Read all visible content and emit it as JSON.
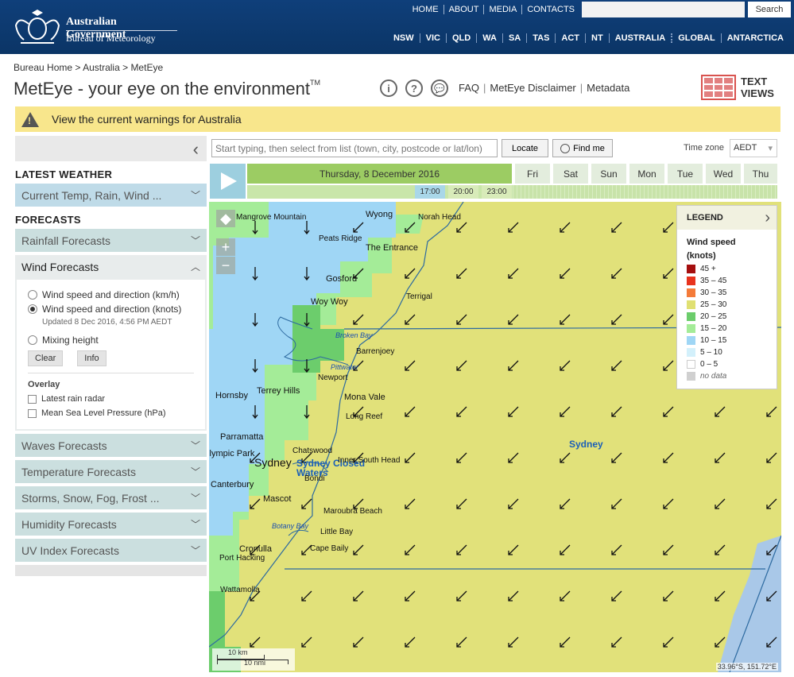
{
  "header": {
    "gov_name": "Australian Government",
    "bureau_name": "Bureau of Meteorology",
    "top_links": [
      "HOME",
      "ABOUT",
      "MEDIA",
      "CONTACTS"
    ],
    "search_button": "Search",
    "state_links": [
      "NSW",
      "VIC",
      "QLD",
      "WA",
      "SA",
      "TAS",
      "ACT",
      "NT",
      "AUSTRALIA",
      "GLOBAL",
      "ANTARCTICA"
    ]
  },
  "breadcrumb": {
    "home": "Bureau Home",
    "sep1": " > ",
    "australia": "Australia",
    "sep2": " > ",
    "current": "MetEye"
  },
  "title": {
    "main": "MetEye",
    "dash": " - ",
    "sub": "your eye on the environment",
    "tm": "TM"
  },
  "help_icons": {
    "info": "i",
    "help": "?",
    "feedback": "💬"
  },
  "title_links": {
    "faq": "FAQ",
    "disclaimer": "MetEye Disclaimer",
    "metadata": "Metadata"
  },
  "text_views": {
    "line1": "TEXT",
    "line2": "VIEWS"
  },
  "warning": {
    "text": "View the current warnings for Australia"
  },
  "sidebar": {
    "latest_heading": "LATEST WEATHER",
    "latest_item": "Current Temp, Rain, Wind ...",
    "forecasts_heading": "FORECASTS",
    "rainfall": "Rainfall Forecasts",
    "wind": "Wind Forecasts",
    "wind_options": {
      "kmh": "Wind speed and direction (km/h)",
      "knots": "Wind speed and direction (knots)",
      "updated": "Updated 8 Dec 2016, 4:56 PM AEDT",
      "mixing": "Mixing height"
    },
    "clear_button": "Clear",
    "info_button": "Info",
    "overlay_heading": "Overlay",
    "overlay_radar": "Latest rain radar",
    "overlay_pressure": "Mean Sea Level Pressure (hPa)",
    "waves": "Waves Forecasts",
    "temperature": "Temperature Forecasts",
    "storms": "Storms, Snow, Fog, Frost ...",
    "humidity": "Humidity Forecasts",
    "uv": "UV Index Forecasts"
  },
  "toolbar": {
    "location_placeholder": "Start typing, then select from list (town, city, postcode or lat/lon)",
    "locate_button": "Locate",
    "findme_button": "Find me",
    "timezone_label": "Time zone",
    "timezone_value": "AEDT"
  },
  "timeline": {
    "selected_day": "Thursday, 8 December 2016",
    "days": [
      "Fri",
      "Sat",
      "Sun",
      "Mon",
      "Tue",
      "Wed",
      "Thu"
    ],
    "hours": [
      "17:00",
      "20:00",
      "23:00"
    ],
    "active_hour": "17:00"
  },
  "map": {
    "places": [
      "Mangrove Mountain",
      "Wyong",
      "Norah Head",
      "Peats Ridge",
      "The Entrance",
      "Gosford",
      "Terrigal",
      "Woy Woy",
      "Broken Bay",
      "Barrenjoey",
      "Pittwater",
      "Newport",
      "Hornsby",
      "Terrey Hills",
      "Mona Vale",
      "Long Reef",
      "Parramatta",
      "Chatswood",
      "Sydney Closed Waters",
      "Olympic Park",
      "Sydney",
      "Inner South Head",
      "Bondi",
      "Canterbury",
      "Mascot",
      "Maroubra Beach",
      "Botany Bay",
      "Little Bay",
      "Cronulla",
      "Cape Baily",
      "Port Hacking",
      "Wattamolla"
    ],
    "region_label": "Sydney",
    "scale_km": "10 km",
    "scale_nmi": "10 nmi",
    "coords": "33.96°S, 151.72°E",
    "zoom_in": "+",
    "zoom_out": "−"
  },
  "legend": {
    "header": "LEGEND",
    "title_line1": "Wind speed",
    "title_line2": "(knots)",
    "items": [
      {
        "label": "45 +",
        "color": "#a50f0f"
      },
      {
        "label": "35 – 45",
        "color": "#e8331d"
      },
      {
        "label": "30 – 35",
        "color": "#f47b3a"
      },
      {
        "label": "25 – 30",
        "color": "#e0e072"
      },
      {
        "label": "20 – 25",
        "color": "#6ccd6c"
      },
      {
        "label": "15 – 20",
        "color": "#a4ec98"
      },
      {
        "label": "10 – 15",
        "color": "#9fd6f5"
      },
      {
        "label": "5 – 10",
        "color": "#d3f0fb"
      },
      {
        "label": "0 – 5",
        "color": "#ffffff"
      },
      {
        "label": "no data",
        "color": "#d0d0d0"
      }
    ]
  }
}
